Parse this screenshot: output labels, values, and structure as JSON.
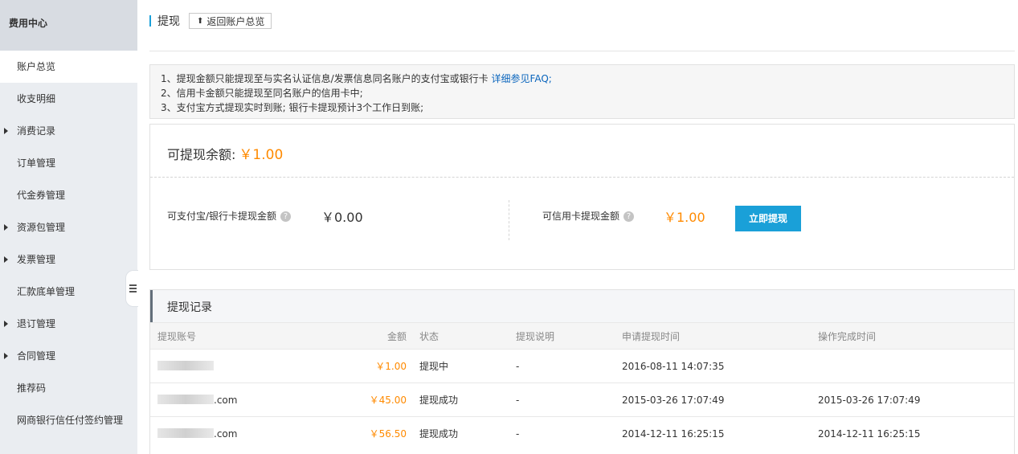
{
  "sidebar": {
    "header": "费用中心",
    "items": [
      {
        "label": "账户总览",
        "active": true,
        "expandable": false
      },
      {
        "label": "收支明细",
        "active": false,
        "expandable": false
      },
      {
        "label": "消费记录",
        "active": false,
        "expandable": true
      },
      {
        "label": "订单管理",
        "active": false,
        "expandable": false
      },
      {
        "label": "代金券管理",
        "active": false,
        "expandable": false
      },
      {
        "label": "资源包管理",
        "active": false,
        "expandable": true
      },
      {
        "label": "发票管理",
        "active": false,
        "expandable": true
      },
      {
        "label": "汇款底单管理",
        "active": false,
        "expandable": false
      },
      {
        "label": "退订管理",
        "active": false,
        "expandable": true
      },
      {
        "label": "合同管理",
        "active": false,
        "expandable": true
      },
      {
        "label": "推荐码",
        "active": false,
        "expandable": false
      },
      {
        "label": "网商银行信任付签约管理",
        "active": false,
        "expandable": false
      }
    ]
  },
  "header": {
    "title": "提现",
    "back_label": "返回账户总览"
  },
  "notice": {
    "line1": "1、提现金额只能提现至与实名认证信息/发票信息同名账户的支付宝或银行卡",
    "line1_link": "详细参见FAQ;",
    "line2": "2、信用卡金额只能提现至同名账户的信用卡中;",
    "line3": "3、支付宝方式提现实时到账; 银行卡提现预计3个工作日到账;"
  },
  "balance": {
    "label": "可提现余额:",
    "amount": "￥1.00",
    "alipay_label": "可支付宝/银行卡提现金额",
    "alipay_amount": "￥0.00",
    "credit_label": "可信用卡提现金额",
    "credit_amount": "￥1.00",
    "withdraw_button": "立即提现"
  },
  "records": {
    "title": "提现记录",
    "columns": [
      "提现账号",
      "金额",
      "状态",
      "提现说明",
      "申请提现时间",
      "操作完成时间"
    ],
    "rows": [
      {
        "account": "",
        "amount": "￥1.00",
        "status": "提现中",
        "note": "-",
        "apply_time": "2016-08-11 14:07:35",
        "done_time": ""
      },
      {
        "account": ".com",
        "amount": "￥45.00",
        "status": "提现成功",
        "note": "-",
        "apply_time": "2015-03-26 17:07:49",
        "done_time": "2015-03-26 17:07:49"
      },
      {
        "account": ".com",
        "amount": "￥56.50",
        "status": "提现成功",
        "note": "-",
        "apply_time": "2014-12-11 16:25:15",
        "done_time": "2014-12-11 16:25:15"
      }
    ]
  },
  "colors": {
    "accent": "#1aa0d8",
    "amount": "#ff8a00",
    "link": "#0a65bd"
  }
}
